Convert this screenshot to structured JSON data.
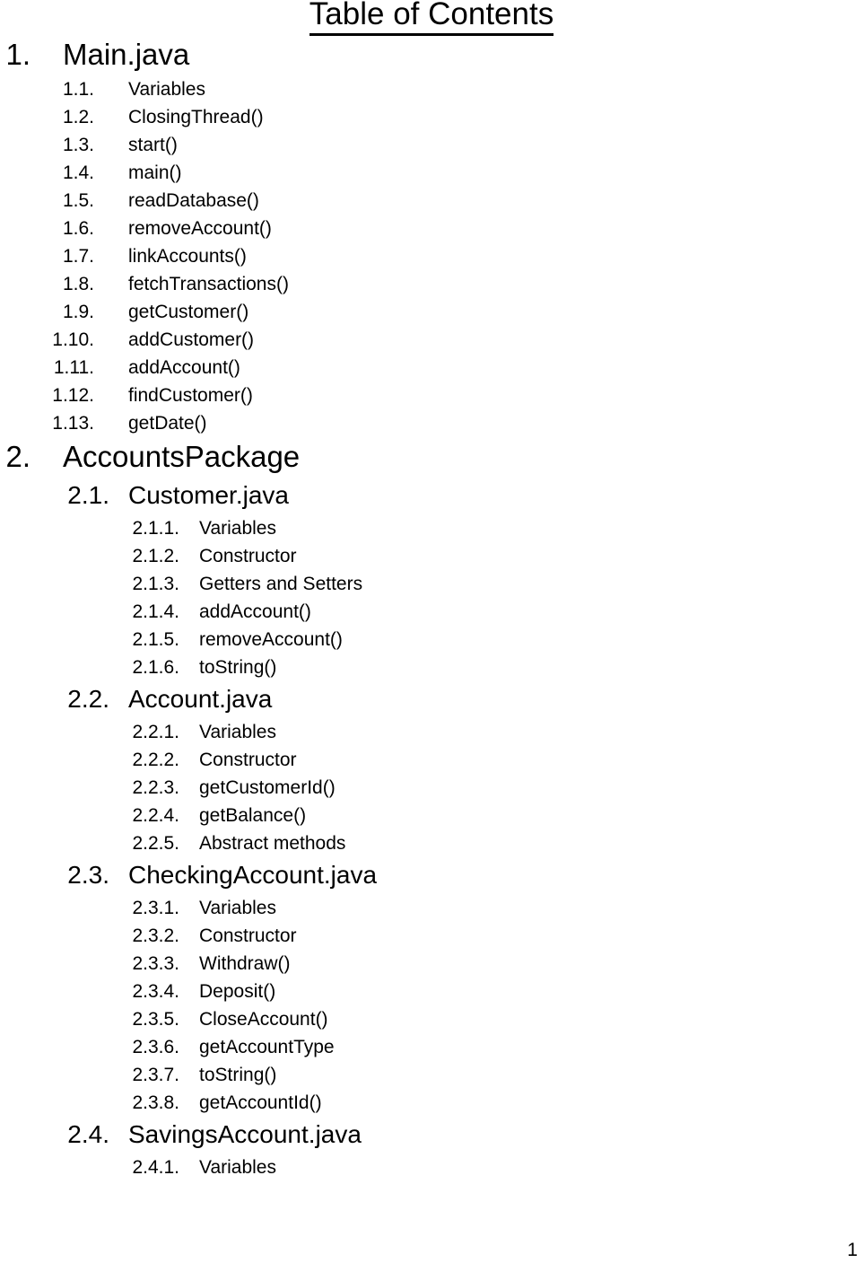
{
  "document": {
    "title": "Table of Contents",
    "page_number": "1"
  },
  "toc": {
    "entries": [
      {
        "level": 1,
        "number": "1.",
        "label": "Main.java"
      },
      {
        "level": 2,
        "number": "1.1.",
        "label": "Variables"
      },
      {
        "level": 2,
        "number": "1.2.",
        "label": "ClosingThread()"
      },
      {
        "level": 2,
        "number": "1.3.",
        "label": "start()"
      },
      {
        "level": 2,
        "number": "1.4.",
        "label": "main()"
      },
      {
        "level": 2,
        "number": "1.5.",
        "label": "readDatabase()"
      },
      {
        "level": 2,
        "number": "1.6.",
        "label": "removeAccount()"
      },
      {
        "level": 2,
        "number": "1.7.",
        "label": "linkAccounts()"
      },
      {
        "level": 2,
        "number": "1.8.",
        "label": "fetchTransactions()"
      },
      {
        "level": 2,
        "number": "1.9.",
        "label": "getCustomer()"
      },
      {
        "level": 2,
        "number": "1.10.",
        "label": "addCustomer()"
      },
      {
        "level": 2,
        "number": "1.11.",
        "label": "addAccount()"
      },
      {
        "level": 2,
        "number": "1.12.",
        "label": "findCustomer()"
      },
      {
        "level": 2,
        "number": "1.13.",
        "label": "getDate()"
      },
      {
        "level": 1,
        "number": "2.",
        "label": "AccountsPackage"
      },
      {
        "level": 2,
        "number": "2.1.",
        "label": "Customer.java",
        "heading": true
      },
      {
        "level": 3,
        "number": "2.1.1.",
        "label": "Variables"
      },
      {
        "level": 3,
        "number": "2.1.2.",
        "label": "Constructor"
      },
      {
        "level": 3,
        "number": "2.1.3.",
        "label": "Getters and Setters"
      },
      {
        "level": 3,
        "number": "2.1.4.",
        "label": "addAccount()"
      },
      {
        "level": 3,
        "number": "2.1.5.",
        "label": "removeAccount()"
      },
      {
        "level": 3,
        "number": "2.1.6.",
        "label": "toString()"
      },
      {
        "level": 2,
        "number": "2.2.",
        "label": "Account.java",
        "heading": true
      },
      {
        "level": 3,
        "number": "2.2.1.",
        "label": "Variables"
      },
      {
        "level": 3,
        "number": "2.2.2.",
        "label": "Constructor"
      },
      {
        "level": 3,
        "number": "2.2.3.",
        "label": "getCustomerId()"
      },
      {
        "level": 3,
        "number": "2.2.4.",
        "label": "getBalance()"
      },
      {
        "level": 3,
        "number": "2.2.5.",
        "label": "Abstract methods"
      },
      {
        "level": 2,
        "number": "2.3.",
        "label": "CheckingAccount.java",
        "heading": true
      },
      {
        "level": 3,
        "number": "2.3.1.",
        "label": "Variables"
      },
      {
        "level": 3,
        "number": "2.3.2.",
        "label": "Constructor"
      },
      {
        "level": 3,
        "number": "2.3.3.",
        "label": "Withdraw()"
      },
      {
        "level": 3,
        "number": "2.3.4.",
        "label": "Deposit()"
      },
      {
        "level": 3,
        "number": "2.3.5.",
        "label": "CloseAccount()"
      },
      {
        "level": 3,
        "number": "2.3.6.",
        "label": "getAccountType"
      },
      {
        "level": 3,
        "number": "2.3.7.",
        "label": "toString()"
      },
      {
        "level": 3,
        "number": "2.3.8.",
        "label": "getAccountId()"
      },
      {
        "level": 2,
        "number": "2.4.",
        "label": "SavingsAccount.java",
        "heading": true
      },
      {
        "level": 3,
        "number": "2.4.1.",
        "label": "Variables"
      }
    ]
  }
}
